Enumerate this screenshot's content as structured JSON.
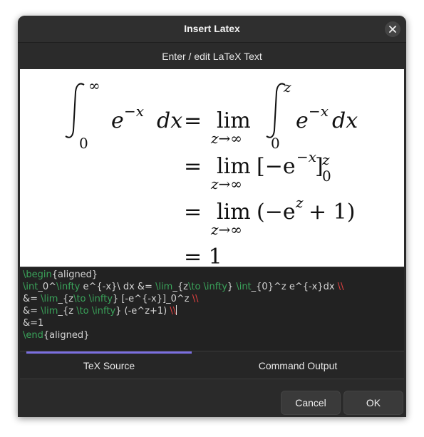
{
  "window": {
    "title": "Insert Latex"
  },
  "section": {
    "header": "Enter / edit LaTeX Text"
  },
  "preview": {
    "line1": {
      "integral_upper": "∞",
      "integral_lower": "0",
      "lhs_base": "e",
      "lhs_exp": "−x",
      "dx": "dx",
      "eq": "=",
      "lim": "lim",
      "lim_sub": "z→∞",
      "int2_upper": "z",
      "int2_lower": "0",
      "rhs_base": "e",
      "rhs_exp": "−x",
      "rhs_dx": "dx"
    },
    "line2": {
      "eq": "=",
      "lim": "lim",
      "lim_sub": "z→∞",
      "bracket_body": "[−e",
      "exp": "−x",
      "close_bracket": "]",
      "sup": "z",
      "sub": "0"
    },
    "line3": {
      "eq": "=",
      "lim": "lim",
      "lim_sub": "z→∞",
      "open_paren": "(−e",
      "exp": "z",
      "rest": "+ 1)"
    },
    "line4": {
      "eq": "= 1"
    }
  },
  "editor": {
    "lines": [
      [
        {
          "t": "\\begin",
          "c": "kw"
        },
        {
          "t": "{aligned}",
          "c": ""
        }
      ],
      [
        {
          "t": "\\int",
          "c": "kw"
        },
        {
          "t": "_0^",
          "c": ""
        },
        {
          "t": "\\infty",
          "c": "kw"
        },
        {
          "t": " e^{-x}\\ dx &= ",
          "c": ""
        },
        {
          "t": "\\lim",
          "c": "kw"
        },
        {
          "t": "_{z",
          "c": ""
        },
        {
          "t": "\\to",
          "c": "kw"
        },
        {
          "t": " ",
          "c": ""
        },
        {
          "t": "\\infty",
          "c": "kw"
        },
        {
          "t": "} ",
          "c": ""
        },
        {
          "t": "\\int",
          "c": "kw"
        },
        {
          "t": "_{0}^z e^{-x}dx ",
          "c": ""
        },
        {
          "t": "\\\\",
          "c": "br"
        }
      ],
      [
        {
          "t": "&= ",
          "c": ""
        },
        {
          "t": "\\lim",
          "c": "kw"
        },
        {
          "t": "_{z",
          "c": ""
        },
        {
          "t": "\\to",
          "c": "kw"
        },
        {
          "t": " ",
          "c": ""
        },
        {
          "t": "\\infty",
          "c": "kw"
        },
        {
          "t": "} [-e^{-x}]_0^z ",
          "c": ""
        },
        {
          "t": "\\\\",
          "c": "br"
        }
      ],
      [
        {
          "t": "&= ",
          "c": ""
        },
        {
          "t": "\\lim",
          "c": "kw"
        },
        {
          "t": "_{z ",
          "c": ""
        },
        {
          "t": "\\to",
          "c": "kw"
        },
        {
          "t": " ",
          "c": ""
        },
        {
          "t": "\\infty",
          "c": "kw"
        },
        {
          "t": "} (-e^z+1) ",
          "c": ""
        },
        {
          "t": "\\\\",
          "c": "br"
        }
      ],
      [
        {
          "t": "&=1",
          "c": ""
        }
      ],
      [
        {
          "t": "\\end",
          "c": "kw"
        },
        {
          "t": "{aligned}",
          "c": ""
        }
      ]
    ]
  },
  "tabs": [
    {
      "label": "TeX Source",
      "active": true
    },
    {
      "label": "Command Output",
      "active": false
    }
  ],
  "buttons": {
    "cancel": "Cancel",
    "ok": "OK"
  },
  "colors": {
    "accent": "#7b6fe0",
    "keyword": "#3aa35a",
    "linebreak": "#e04040"
  }
}
